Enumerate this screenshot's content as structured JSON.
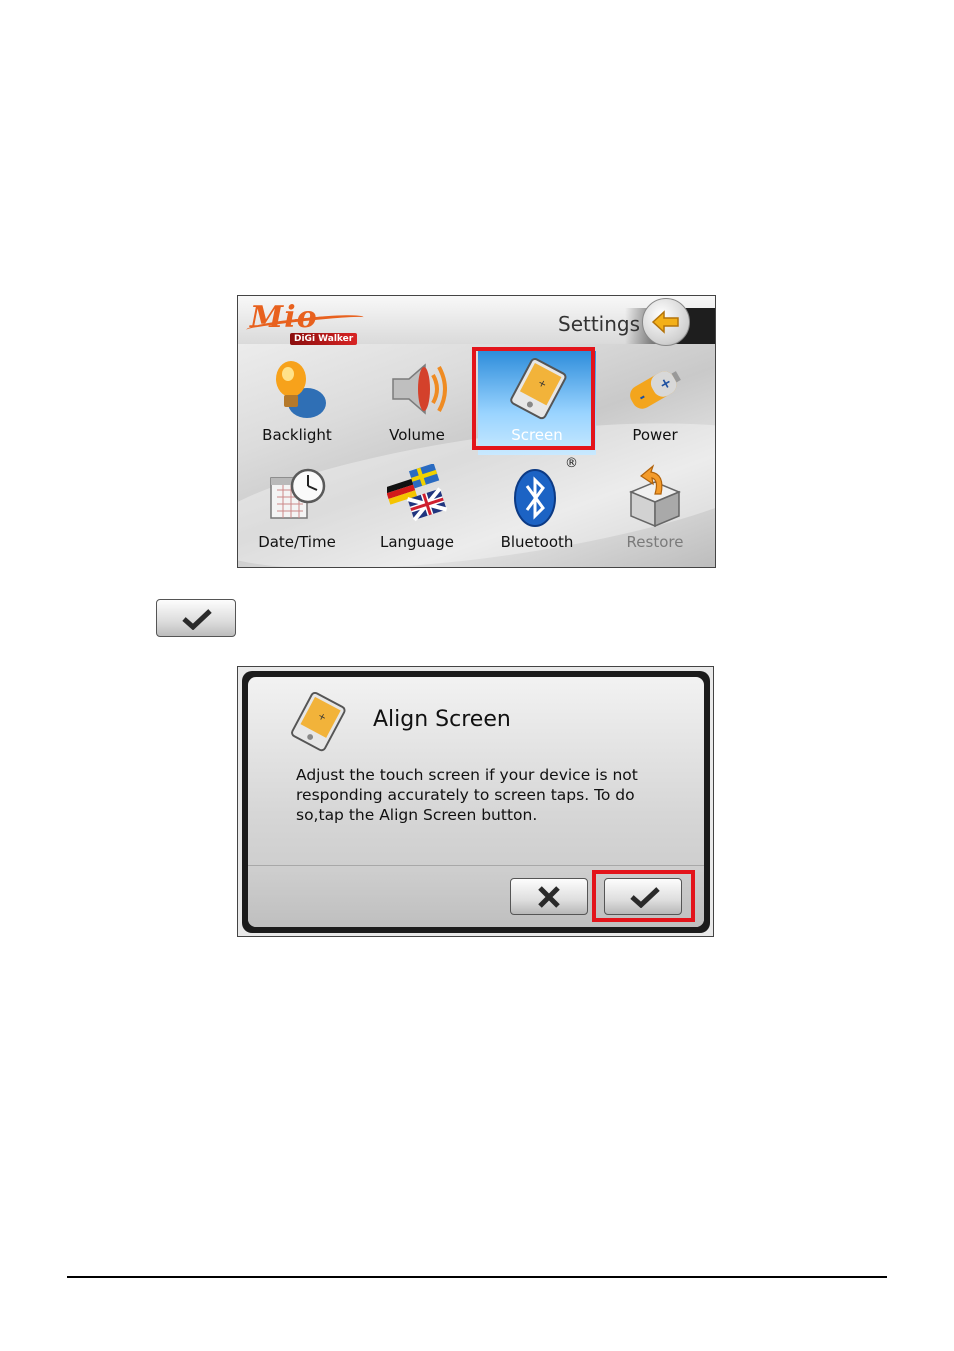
{
  "settings_screen": {
    "logo": {
      "brand": "Mio",
      "product_prefix": "DiGi",
      "product": "Walker"
    },
    "title": "Settings",
    "items": [
      {
        "label": "Backlight",
        "icon": "lightbulb-icon"
      },
      {
        "label": "Volume",
        "icon": "speaker-icon"
      },
      {
        "label": "Screen",
        "icon": "screen-device-icon",
        "selected": true
      },
      {
        "label": "Power",
        "icon": "battery-icon"
      },
      {
        "label": "Date/Time",
        "icon": "calendar-clock-icon"
      },
      {
        "label": "Language",
        "icon": "flags-icon"
      },
      {
        "label": "Bluetooth",
        "icon": "bluetooth-icon",
        "mark": "®"
      },
      {
        "label": "Restore",
        "icon": "restore-box-icon"
      }
    ]
  },
  "ok_button_icon": "checkmark-icon",
  "align_dialog": {
    "title": "Align Screen",
    "text": "Adjust the touch screen if your device is not responding accurately to screen taps. To do so,tap the Align Screen button.",
    "cancel_icon": "x-icon",
    "ok_icon": "checkmark-icon"
  },
  "colors": {
    "highlight": "#e3141b",
    "accent_orange": "#e8611e",
    "selection_blue": "#2e8ddb"
  }
}
